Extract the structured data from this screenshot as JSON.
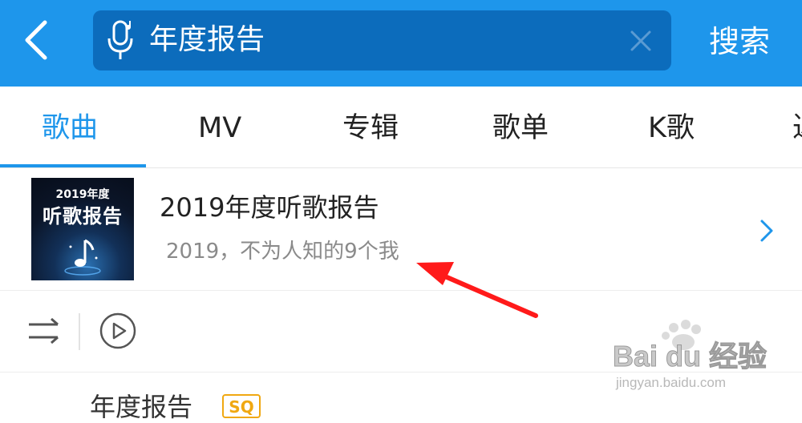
{
  "header": {
    "search_query": "年度报告",
    "search_button_label": "搜索",
    "accent_color": "#1e96eb"
  },
  "tabs": [
    {
      "label": "歌曲",
      "active": true
    },
    {
      "label": "MV",
      "active": false
    },
    {
      "label": "专辑",
      "active": false
    },
    {
      "label": "歌单",
      "active": false
    },
    {
      "label": "K歌",
      "active": false
    },
    {
      "label": "込",
      "active": false
    }
  ],
  "result": {
    "cover_year": "2019年度",
    "cover_title": "听歌报告",
    "title": "2019年度听歌报告",
    "subtitle": "2019，不为人知的9个我"
  },
  "next_item": {
    "title": "年度报告",
    "badge": "SQ"
  },
  "watermark": {
    "brand": "Bai du 经验",
    "url": "jingyan.baidu.com"
  }
}
